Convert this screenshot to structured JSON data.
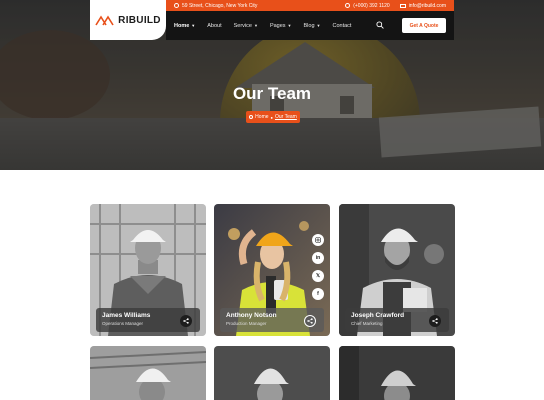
{
  "brand": {
    "name": "RIBUILD",
    "accent": "#e8501a"
  },
  "topbar": {
    "address": "59 Street, Chicago, New York City",
    "phone": "(+000) 392 1120",
    "email": "info@ribuild.com"
  },
  "nav": {
    "items": [
      "Home",
      "About",
      "Service",
      "Pages",
      "Blog",
      "Contact"
    ],
    "active": "Home",
    "cta": "Get A Quote"
  },
  "hero": {
    "title": "Our Team",
    "breadcrumb": {
      "home": "Home",
      "current": "Our Team"
    }
  },
  "team": [
    {
      "name": "James Williams",
      "role": "Operations Manager"
    },
    {
      "name": "Anthony Notson",
      "role": "Production Manager"
    },
    {
      "name": "Joseph Crawford",
      "role": "Chief Marketing"
    }
  ],
  "social": [
    "instagram-icon",
    "linkedin-icon",
    "x-icon",
    "facebook-icon"
  ]
}
